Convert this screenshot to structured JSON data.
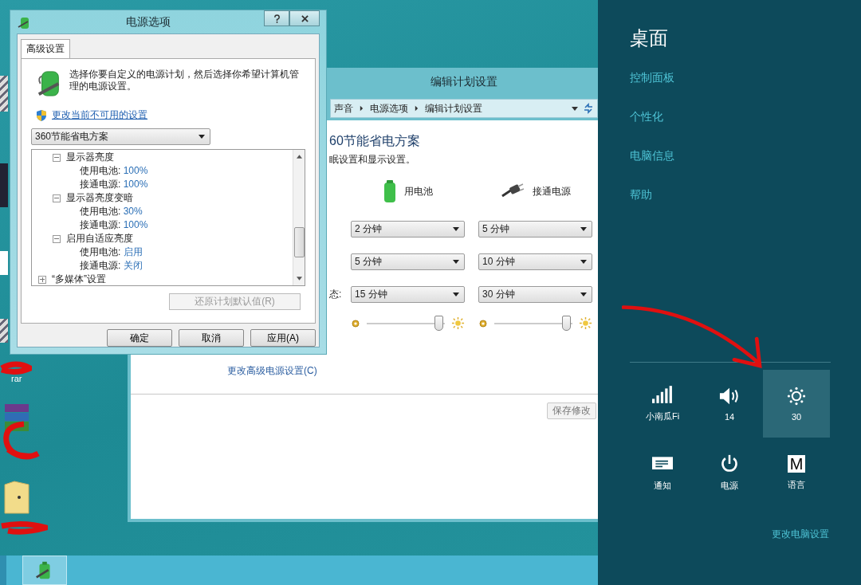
{
  "desktop": {
    "icon_labels": [
      "rar"
    ]
  },
  "edit_plan_window": {
    "title": "编辑计划设置",
    "breadcrumb": [
      "声音",
      "电源选项",
      "编辑计划设置"
    ],
    "heading": "60节能省电方案",
    "subtitle": "眠设置和显示设置。",
    "columns": [
      "用电池",
      "接通电源"
    ],
    "rows": [
      {
        "values": [
          "2 分钟",
          "5 分钟"
        ]
      },
      {
        "values": [
          "5 分钟",
          "10 分钟"
        ]
      },
      {
        "label": "态:",
        "values": [
          "15 分钟",
          "30 分钟"
        ]
      }
    ],
    "brightness_sliders": [
      {
        "level": 0.92
      },
      {
        "level": 0.92
      }
    ],
    "link": "更改高级电源设置(C)",
    "save_button": "保存修改"
  },
  "power_options_dialog": {
    "title": "电源选项",
    "tab": {
      "label": "高级设置",
      "selected": true
    },
    "description": "选择你要自定义的电源计划，然后选择你希望计算机管理的电源设置。",
    "link": "更改当前不可用的设置",
    "plan_dropdown": "360节能省电方案",
    "tree": [
      {
        "label": "显示器亮度",
        "expanded": true,
        "children": [
          {
            "label": "使用电池:",
            "value": "100%"
          },
          {
            "label": "接通电源:",
            "value": "100%"
          }
        ]
      },
      {
        "label": "显示器亮度变暗",
        "expanded": true,
        "children": [
          {
            "label": "使用电池:",
            "value": "30%"
          },
          {
            "label": "接通电源:",
            "value": "100%"
          }
        ]
      },
      {
        "label": "启用自适应亮度",
        "expanded": true,
        "children": [
          {
            "label": "使用电池:",
            "value": "启用"
          },
          {
            "label": "接通电源:",
            "value": "关闭"
          }
        ]
      },
      {
        "label": "“多媒体”设置",
        "expanded": false
      }
    ],
    "restore_button": {
      "label": "还原计划默认值(R)",
      "disabled": true
    },
    "buttons": [
      "确定",
      "取消",
      "应用(A)"
    ]
  },
  "charms": {
    "title": "桌面",
    "links": [
      "控制面板",
      "个性化",
      "电脑信息",
      "帮助"
    ],
    "quick_settings": [
      {
        "kind": "wifi",
        "label": "小南瓜Fi",
        "selected": false
      },
      {
        "kind": "volume",
        "label": "14",
        "selected": false
      },
      {
        "kind": "brightness",
        "label": "30",
        "selected": true
      },
      {
        "kind": "notifications",
        "label": "通知",
        "selected": false
      },
      {
        "kind": "power",
        "label": "电源",
        "selected": false
      },
      {
        "kind": "keyboard",
        "glyph": "M",
        "label": "语言",
        "selected": false
      }
    ],
    "footer_link": "更改电脑设置"
  }
}
